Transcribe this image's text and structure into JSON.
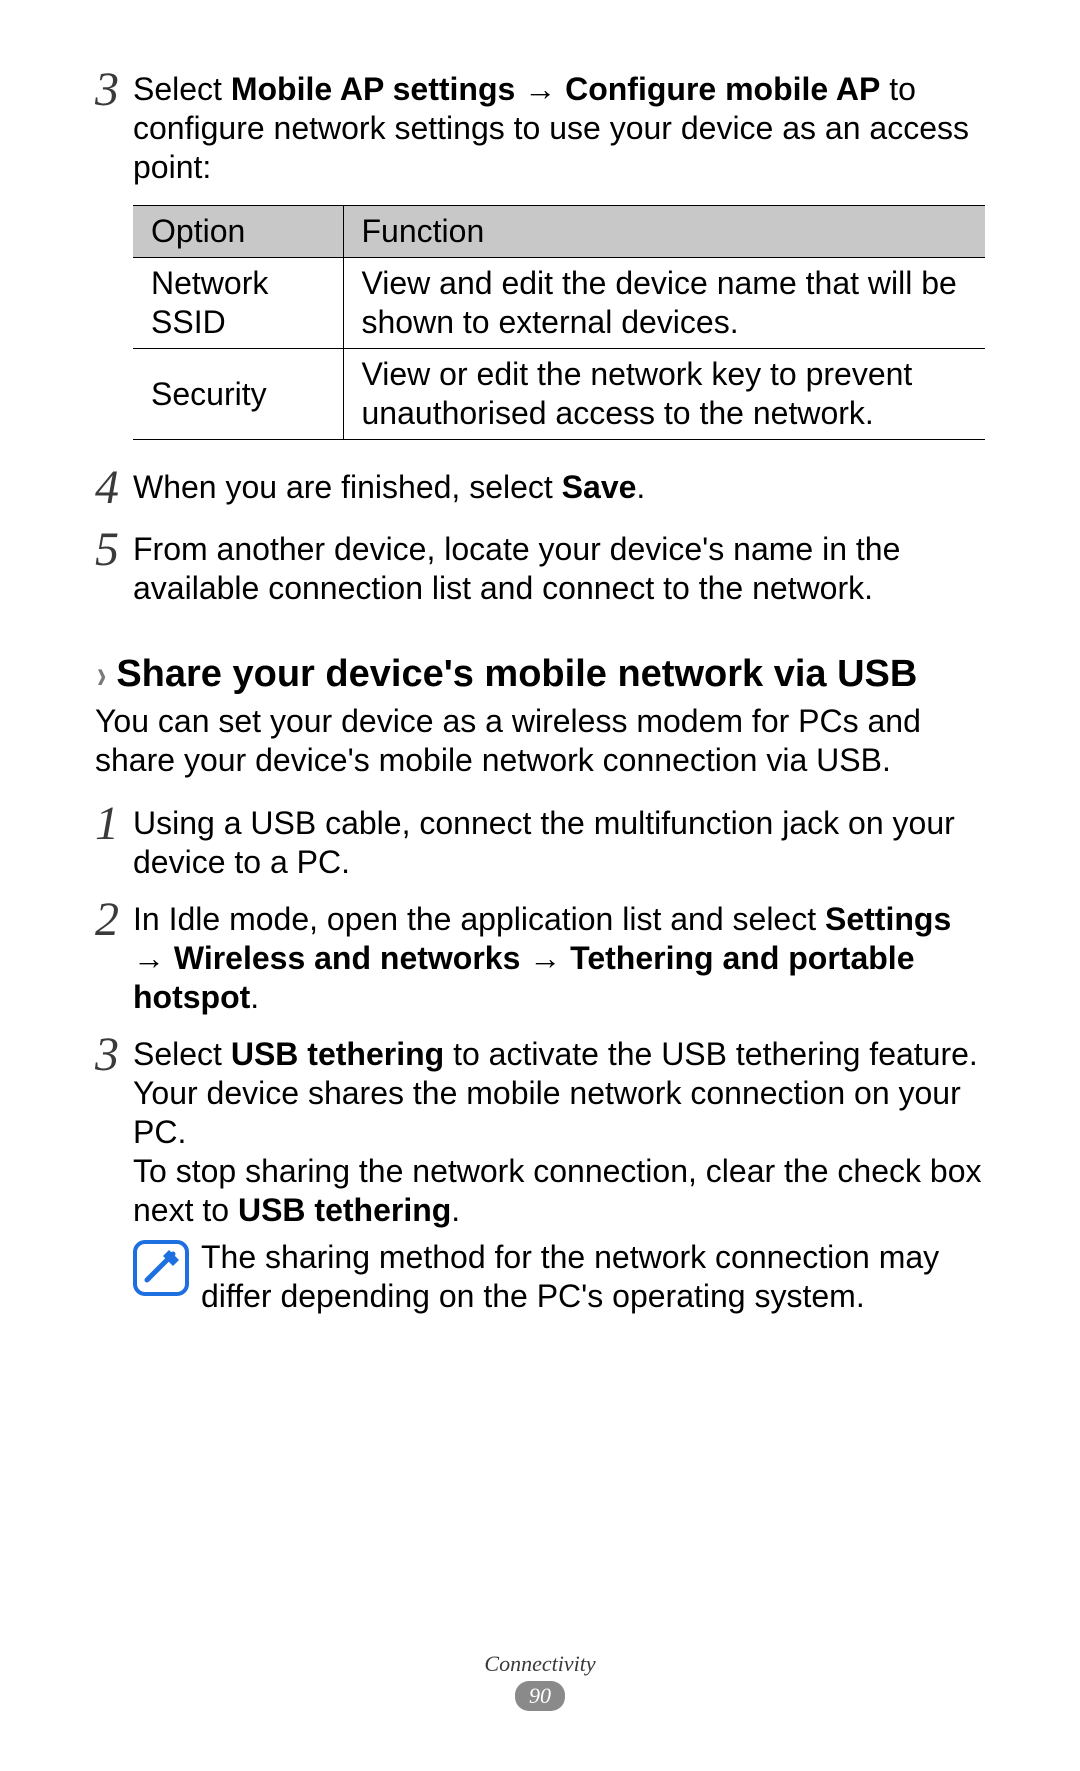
{
  "steps_a": [
    {
      "num": "3",
      "html": "Select <b>Mobile AP settings</b> → <b>Configure mobile AP</b> to configure network settings to use your device as an access point:"
    }
  ],
  "table": {
    "headers": [
      "Option",
      "Function"
    ],
    "rows": [
      [
        "Network SSID",
        "View and edit the device name that will be shown to external devices."
      ],
      [
        "Security",
        "View or edit the network key to prevent unauthorised access to the network."
      ]
    ]
  },
  "steps_b": [
    {
      "num": "4",
      "html": "When you are finished, select <b>Save</b>."
    },
    {
      "num": "5",
      "html": "From another device, locate your device's name in the available connection list and connect to the network."
    }
  ],
  "section": {
    "title": "Share your device's mobile network via USB",
    "intro": "You can set your device as a wireless modem for PCs and share your device's mobile network connection via USB.",
    "steps": [
      {
        "num": "1",
        "html": "Using a USB cable, connect the multifunction jack on your device to a PC."
      },
      {
        "num": "2",
        "html": "In Idle mode, open the application list and select <b>Settings</b> → <b>Wireless and networks</b> → <b>Tethering and portable hotspot</b>."
      },
      {
        "num": "3",
        "html": "Select <b>USB tethering</b> to activate the USB tethering feature.<br>Your device shares the mobile network connection on your PC.<br>To stop sharing the network connection, clear the check box next to <b>USB tethering</b>."
      }
    ],
    "note": "The sharing method for the network connection may differ depending on the PC's operating system."
  },
  "footer": {
    "section": "Connectivity",
    "page": "90"
  }
}
